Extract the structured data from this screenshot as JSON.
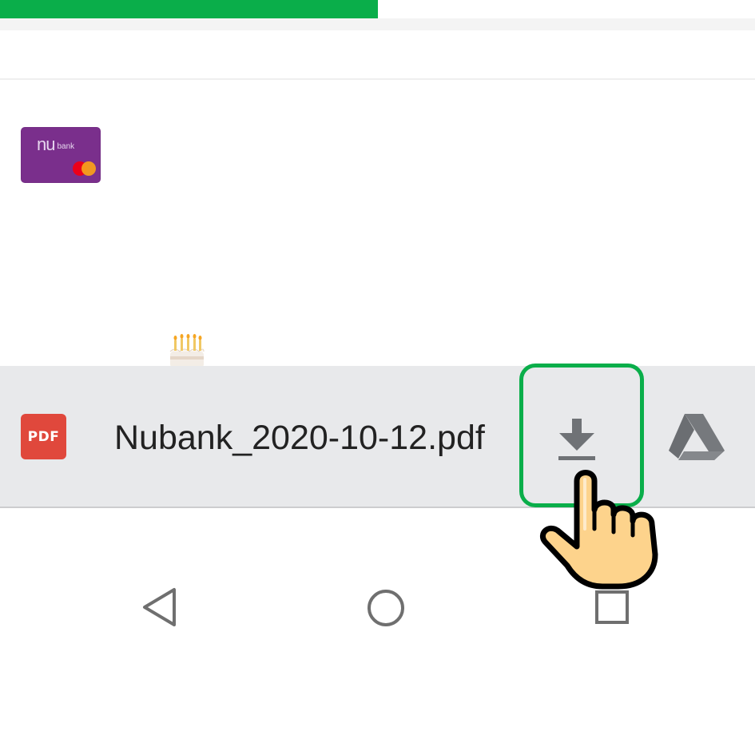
{
  "progress": {
    "value": 0.5,
    "color": "#0aae4a"
  },
  "card": {
    "brand": "nu",
    "brand_suffix": "bank",
    "icon": "nubank-card-icon"
  },
  "emoji": {
    "icon": "birthday-cake-icon"
  },
  "download_bar": {
    "file_type_label": "PDF",
    "file_name": "Nubank_2020-10-12.pdf",
    "download_icon": "download-icon",
    "drive_icon": "google-drive-icon",
    "pdf_color": "#e0483c",
    "highlight_color": "#0aae4a"
  },
  "annotation": {
    "icon": "pointing-hand-icon"
  },
  "nav": {
    "back_icon": "back-triangle-icon",
    "home_icon": "home-circle-icon",
    "recents_icon": "recents-square-icon"
  }
}
